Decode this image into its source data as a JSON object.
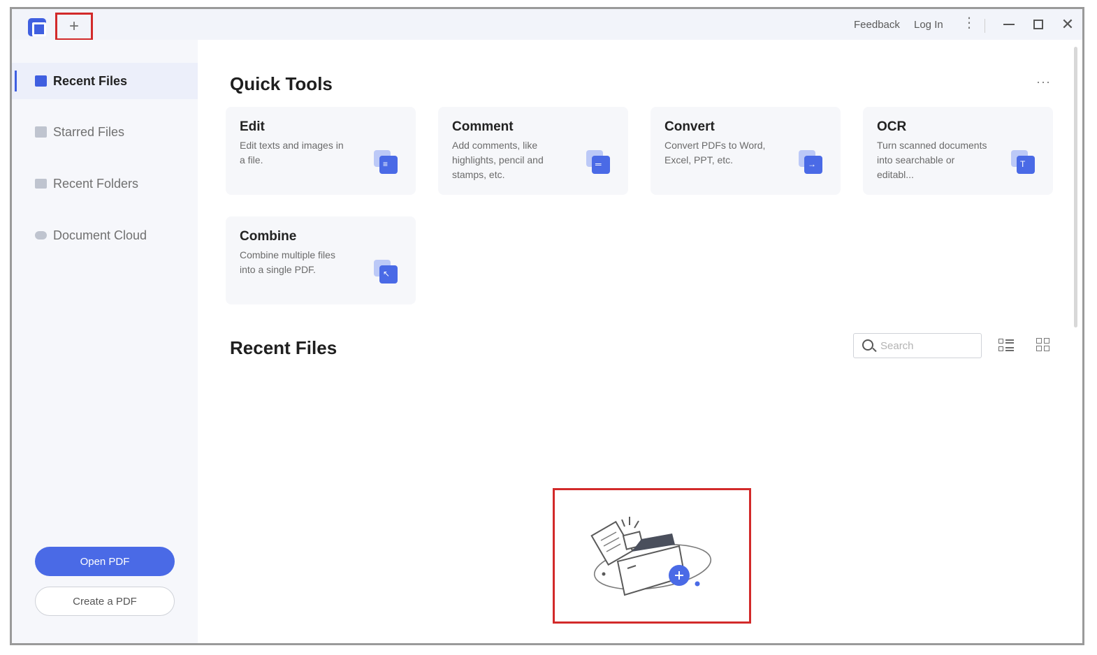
{
  "titlebar": {
    "new_tab_glyph": "+",
    "feedback": "Feedback",
    "login": "Log In",
    "more_glyph": "⋮",
    "close_glyph": "✕"
  },
  "sidebar": {
    "items": [
      {
        "label": "Recent Files",
        "icon": "recent-files-icon",
        "active": true
      },
      {
        "label": "Starred Files",
        "icon": "star-icon",
        "active": false
      },
      {
        "label": "Recent Folders",
        "icon": "folder-icon",
        "active": false
      },
      {
        "label": "Document Cloud",
        "icon": "cloud-icon",
        "active": false
      }
    ],
    "open_pdf": "Open PDF",
    "create_pdf": "Create a PDF"
  },
  "quick_tools": {
    "title": "Quick Tools",
    "more": "···",
    "cards": [
      {
        "title": "Edit",
        "desc": "Edit texts and images in a file.",
        "icon": "edit-icon"
      },
      {
        "title": "Comment",
        "desc": "Add comments, like highlights, pencil and stamps, etc.",
        "icon": "comment-icon"
      },
      {
        "title": "Convert",
        "desc": "Convert PDFs to Word, Excel, PPT, etc.",
        "icon": "convert-icon"
      },
      {
        "title": "OCR",
        "desc": "Turn scanned documents into searchable or editabl...",
        "icon": "ocr-icon"
      },
      {
        "title": "Combine",
        "desc": "Combine multiple files into a single PDF.",
        "icon": "combine-icon"
      }
    ]
  },
  "recent_files": {
    "title": "Recent Files",
    "search_placeholder": "Search",
    "empty_icon": "empty-folder-illustration"
  },
  "colors": {
    "accent": "#4a6ae6",
    "highlight_frame": "#d22a2a",
    "sidebar_bg": "#f6f7fb"
  }
}
